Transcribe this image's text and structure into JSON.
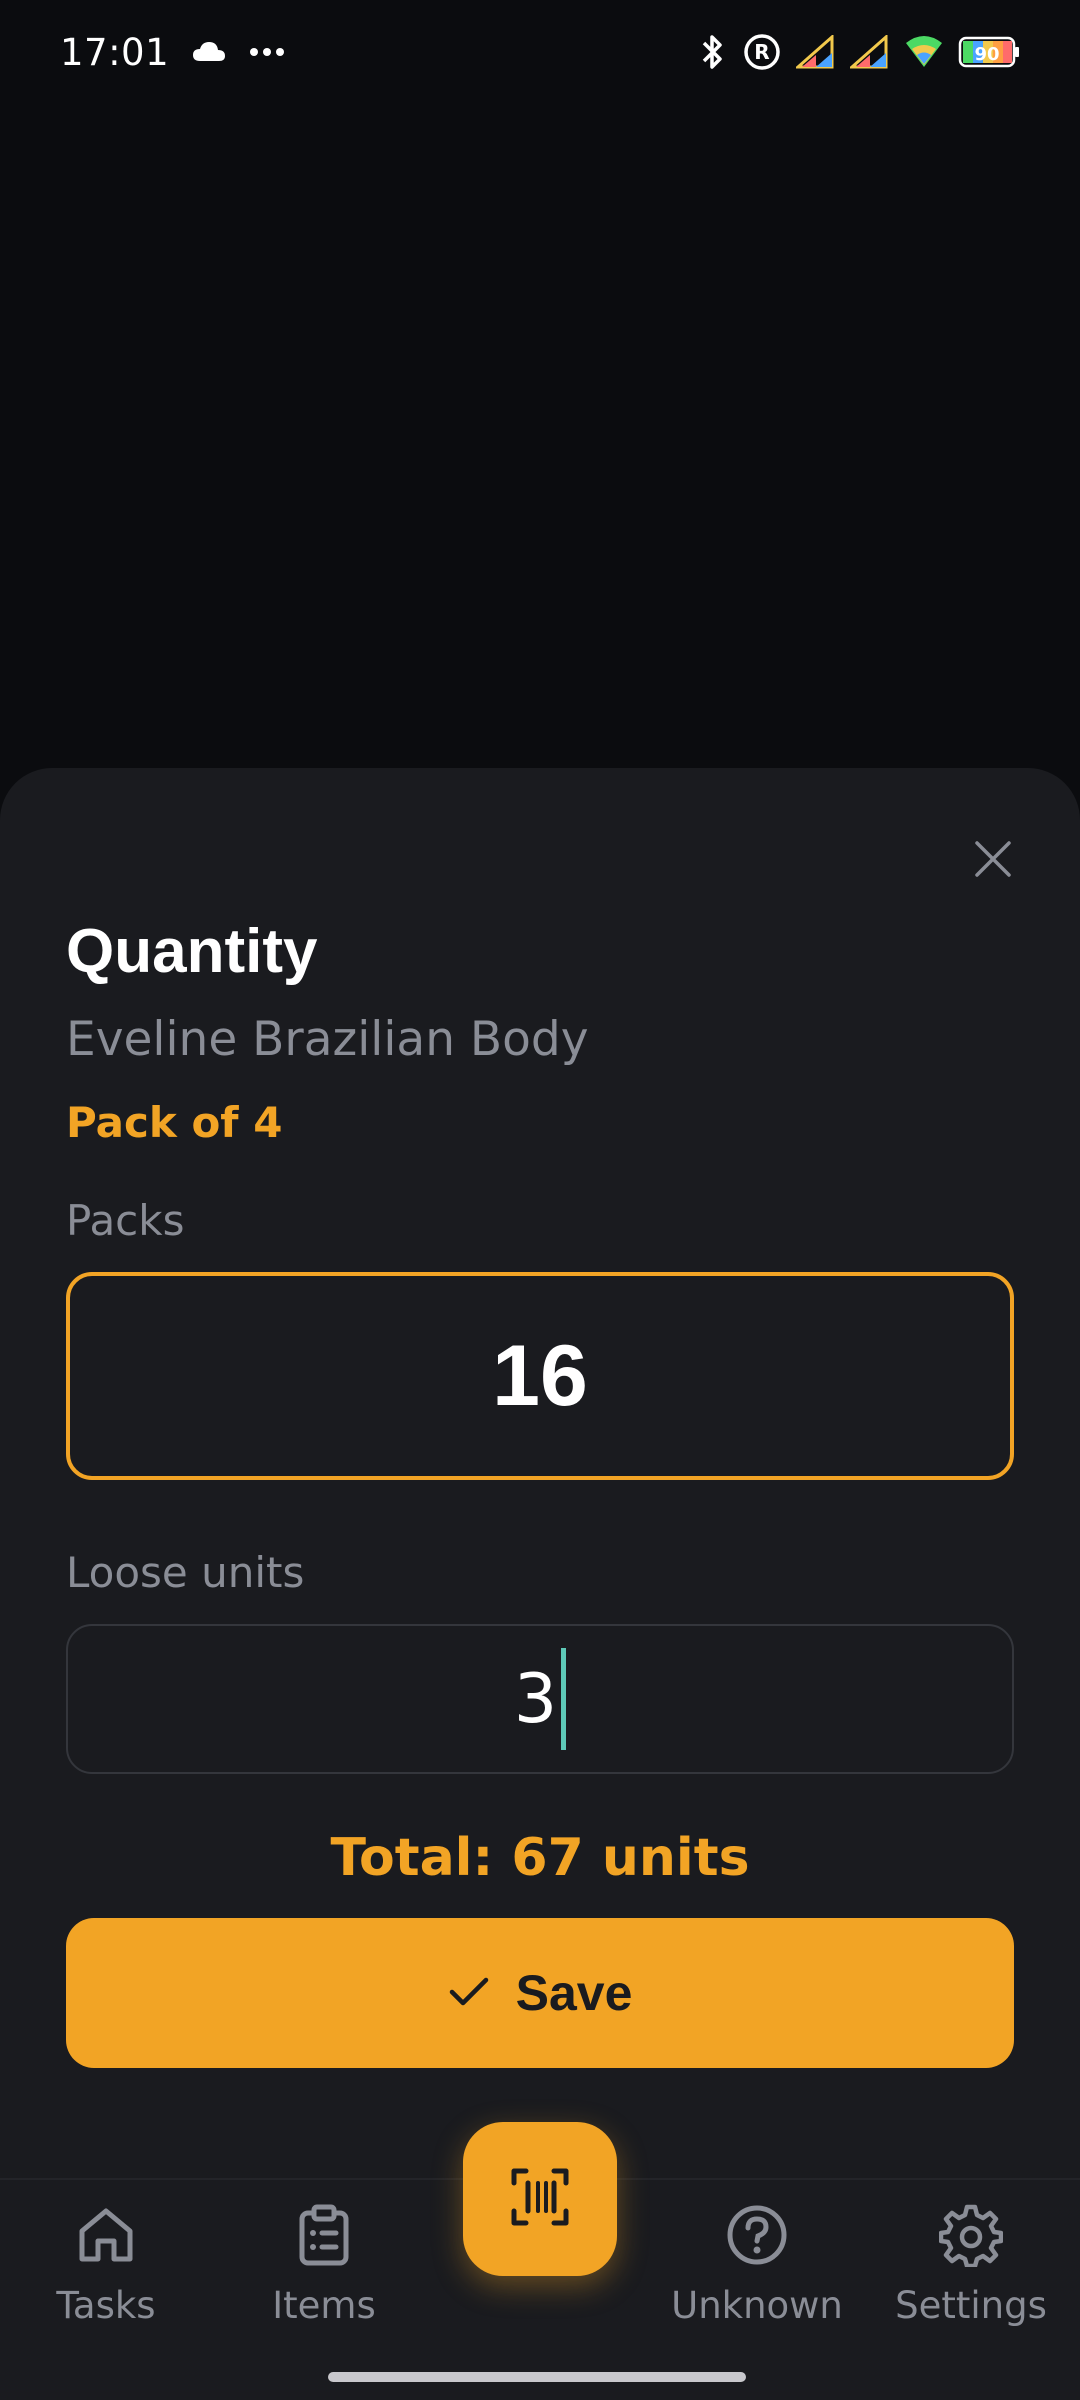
{
  "status_bar": {
    "time": "17:01",
    "battery": "90",
    "icons": [
      "cloud-icon",
      "more-dots-icon",
      "bluetooth-icon",
      "registered-icon",
      "signal-icon",
      "signal-icon",
      "wifi-icon",
      "battery-icon"
    ]
  },
  "sheet": {
    "title": "Quantity",
    "product_name": "Eveline Brazilian Body",
    "pack_label": "Pack of 4",
    "packs_label": "Packs",
    "packs_value": "16",
    "loose_label": "Loose units",
    "loose_value": "3",
    "total": "Total: 67 units",
    "save_label": "Save",
    "close_icon": "close-icon"
  },
  "nav": {
    "tasks": "Tasks",
    "items": "Items",
    "unknown": "Unknown",
    "settings": "Settings",
    "scan_icon": "barcode-scan-icon"
  },
  "colors": {
    "accent": "#f2a425",
    "background": "#0b0c0f",
    "surface": "#1a1b1f",
    "muted_text": "#8a8d96",
    "caret": "#5ec9b8"
  }
}
